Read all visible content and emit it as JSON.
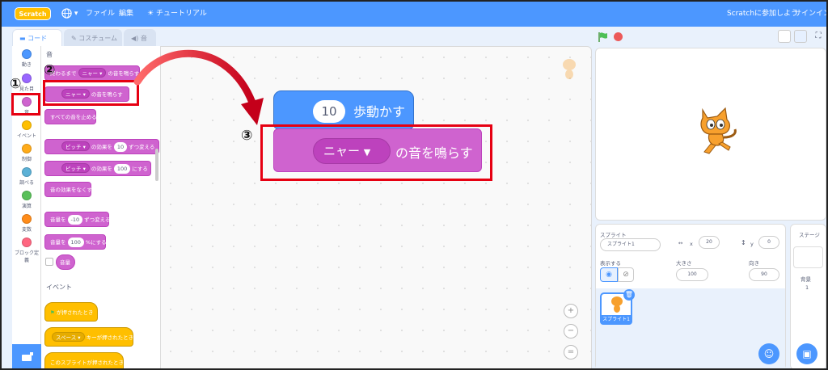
{
  "menubar": {
    "logo": "Scratch",
    "file": "ファイル",
    "edit": "編集",
    "tutorials": "チュートリアル",
    "join": "Scratchに参加しよう",
    "signin": "サインイン",
    "globe_icon": "globe-icon",
    "bulb_icon": "lightbulb-icon"
  },
  "tabs": {
    "code": "コード",
    "costume": "コスチューム",
    "sound": "音"
  },
  "categories": [
    {
      "label": "動き",
      "color": "#4c97ff"
    },
    {
      "label": "見た目",
      "color": "#9966ff"
    },
    {
      "label": "音",
      "color": "#cf63cf"
    },
    {
      "label": "イベント",
      "color": "#ffbf00"
    },
    {
      "label": "制御",
      "color": "#ffab19"
    },
    {
      "label": "調べる",
      "color": "#5cb1d6"
    },
    {
      "label": "演算",
      "color": "#59c059"
    },
    {
      "label": "変数",
      "color": "#ff8c1a"
    },
    {
      "label": "ブロック定義",
      "color": "#ff6680"
    }
  ],
  "palette": {
    "heading_sound": "音",
    "b1": {
      "pre": "終わるまで",
      "dd": "ニャー",
      "post": "の音を鳴らす"
    },
    "b2": {
      "dd": "ニャー",
      "post": "の音を鳴らす"
    },
    "b3": "すべての音を止める",
    "b4": {
      "dd": "ピッチ",
      "mid": "の効果を",
      "val": "10",
      "post": "ずつ変える"
    },
    "b5": {
      "dd": "ピッチ",
      "mid": "の効果を",
      "val": "100",
      "post": "にする"
    },
    "b6": "音の効果をなくす",
    "b7": {
      "pre": "音量を",
      "val": "-10",
      "post": "ずつ変える"
    },
    "b8": {
      "pre": "音量を",
      "val": "100",
      "post": "%にする"
    },
    "b9": "音量",
    "heading_events": "イベント",
    "e1": "が押されたとき",
    "e2": {
      "dd": "スペース",
      "post": "キーが押されたとき"
    },
    "e3": "このスプライトが押されたとき"
  },
  "script": {
    "move_value": "10",
    "move_label": "歩動かす",
    "sound_dd": "ニャー",
    "sound_label": "の音を鳴らす"
  },
  "annotations": {
    "n1": "①",
    "n2": "②",
    "n3": "③"
  },
  "sprite_panel": {
    "sprite_label": "スプライト",
    "sprite_name": "スプライト1",
    "x_label": "x",
    "x_value": "20",
    "y_label": "y",
    "y_value": "0",
    "show_label": "表示する",
    "size_label": "大きさ",
    "size_value": "100",
    "direction_label": "向き",
    "direction_value": "90",
    "thumb_label": "スプライト1"
  },
  "stage_panel": {
    "label": "ステージ",
    "backdrop_label": "背景",
    "backdrop_count": "1"
  },
  "zoom": {
    "in": "+",
    "out": "−",
    "reset": "="
  },
  "colors": {
    "accent": "#4c97ff",
    "sound": "#cf63cf",
    "motion": "#4c97ff",
    "annotation": "#e60012"
  }
}
